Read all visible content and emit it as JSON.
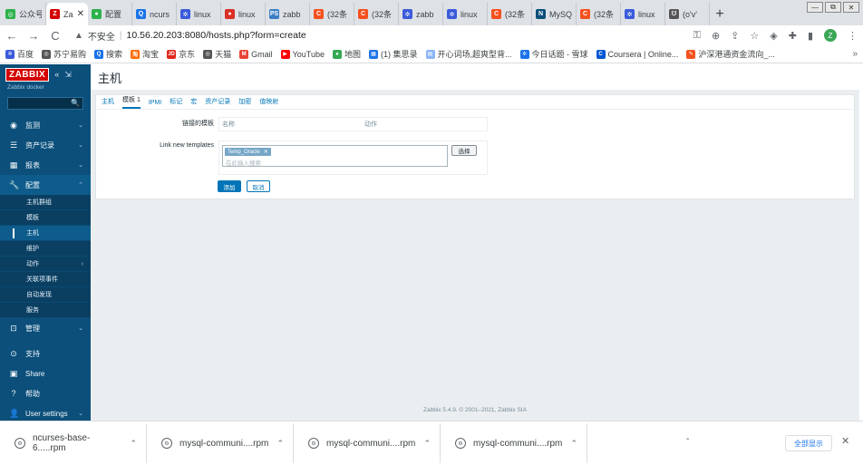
{
  "browser": {
    "tabs": [
      {
        "label": "公众号",
        "color": "#2db24b",
        "glyph": "◎"
      },
      {
        "label": "Za",
        "color": "#d40000",
        "glyph": "Z",
        "active": true
      },
      {
        "label": "配置",
        "color": "#2db24b",
        "glyph": "●"
      },
      {
        "label": "ncurs",
        "color": "#1a73e8",
        "glyph": "Q"
      },
      {
        "label": "linux",
        "color": "#3b5bdb",
        "glyph": "✲"
      },
      {
        "label": "linux",
        "color": "#d93025",
        "glyph": "●"
      },
      {
        "label": "zabb",
        "color": "#3b7ec5",
        "glyph": "PS"
      },
      {
        "label": "(32条",
        "color": "#f4511e",
        "glyph": "C"
      },
      {
        "label": "(32条",
        "color": "#f4511e",
        "glyph": "C"
      },
      {
        "label": "zabb",
        "color": "#3b5bdb",
        "glyph": "✲"
      },
      {
        "label": "linux",
        "color": "#3b5bdb",
        "glyph": "✲"
      },
      {
        "label": "(32条",
        "color": "#f4511e",
        "glyph": "C"
      },
      {
        "label": "MySQ",
        "color": "#0b4f7a",
        "glyph": "N"
      },
      {
        "label": "(32条",
        "color": "#f4511e",
        "glyph": "C"
      },
      {
        "label": "linux",
        "color": "#3b5bdb",
        "glyph": "✲"
      },
      {
        "label": "(o'v'",
        "color": "#555555",
        "glyph": "ᕫ"
      }
    ],
    "active_tab_close": "✕",
    "new_tab": "+",
    "window_controls": {
      "minimize": "—",
      "restore": "⧉",
      "close": "✕"
    },
    "nav": {
      "back": "←",
      "forward": "→",
      "reload": "C"
    },
    "insecure_label": "不安全",
    "url": "10.56.20.203:8080/hosts.php?form=create",
    "profile_initial": "Z",
    "bookmarks": [
      {
        "label": "百度",
        "color": "#3b5bdb",
        "glyph": "✲"
      },
      {
        "label": "苏宁易购",
        "color": "#555555",
        "glyph": "◎"
      },
      {
        "label": "搜索",
        "color": "#1a73e8",
        "glyph": "Q"
      },
      {
        "label": "淘宝",
        "color": "#ff6a00",
        "glyph": "淘"
      },
      {
        "label": "京东",
        "color": "#e1251b",
        "glyph": "JD"
      },
      {
        "label": "天猫",
        "color": "#555555",
        "glyph": "◎"
      },
      {
        "label": "Gmail",
        "color": "#ea4335",
        "glyph": "M"
      },
      {
        "label": "YouTube",
        "color": "#ff0000",
        "glyph": "▶"
      },
      {
        "label": "地图",
        "color": "#34a853",
        "glyph": "●"
      },
      {
        "label": "(1) 集思录",
        "color": "#1a73e8",
        "glyph": "▦"
      },
      {
        "label": "开心词场,超爽型背...",
        "color": "#8ab4f8",
        "glyph": "▤"
      },
      {
        "label": "今日话题 - 雪球",
        "color": "#1a73e8",
        "glyph": "✲"
      },
      {
        "label": "Coursera | Online...",
        "color": "#0056d2",
        "glyph": "C"
      },
      {
        "label": "沪深港通资金流向_...",
        "color": "#f4511e",
        "glyph": "✎"
      }
    ],
    "bookmarks_more": "»"
  },
  "sidebar": {
    "logo": "ZABBIX",
    "server_name": "Zabbix docker",
    "menu": [
      {
        "label": "监测",
        "icon": "◉"
      },
      {
        "label": "资产记录",
        "icon": "☰"
      },
      {
        "label": "报表",
        "icon": "▦"
      },
      {
        "label": "配置",
        "icon": "🔧"
      }
    ],
    "config_submenu": [
      {
        "label": "主机群组"
      },
      {
        "label": "模板"
      },
      {
        "label": "主机",
        "selected": true
      },
      {
        "label": "维护"
      },
      {
        "label": "动作",
        "has_children": true
      },
      {
        "label": "关联项事件"
      },
      {
        "label": "自动发现"
      },
      {
        "label": "服务"
      }
    ],
    "admin": {
      "label": "管理",
      "icon": "⊡"
    },
    "footer": [
      {
        "label": "支持",
        "icon": "⊙"
      },
      {
        "label": "Share",
        "icon": "▣"
      },
      {
        "label": "帮助",
        "icon": "?"
      },
      {
        "label": "User settings",
        "icon": "👤"
      }
    ]
  },
  "main": {
    "title": "主机",
    "tabs": [
      "主机",
      "模板 1",
      "IPMI",
      "标记",
      "宏",
      "资产记录",
      "加密",
      "值映射"
    ],
    "active_tab_index": 1,
    "linked_templates_label": "链接的模板",
    "linked_table_headers": [
      "名称",
      "动作"
    ],
    "link_new_templates_label": "Link new templates",
    "chip_label": "Temp_Oracle",
    "chip_remove": "✕",
    "input_placeholder": "在此输入搜索",
    "select_button": "选择",
    "add_button": "添加",
    "cancel_button": "取消",
    "footer": "Zabbix 5.4.9. © 2001–2021, Zabbix SIA"
  },
  "downloads": {
    "items": [
      {
        "name": "ncurses-base-6.....rpm"
      },
      {
        "name": "mysql-communi....rpm"
      },
      {
        "name": "mysql-communi....rpm"
      },
      {
        "name": "mysql-communi....rpm"
      }
    ],
    "dash": "-",
    "show_all": "全部显示",
    "close": "✕"
  }
}
